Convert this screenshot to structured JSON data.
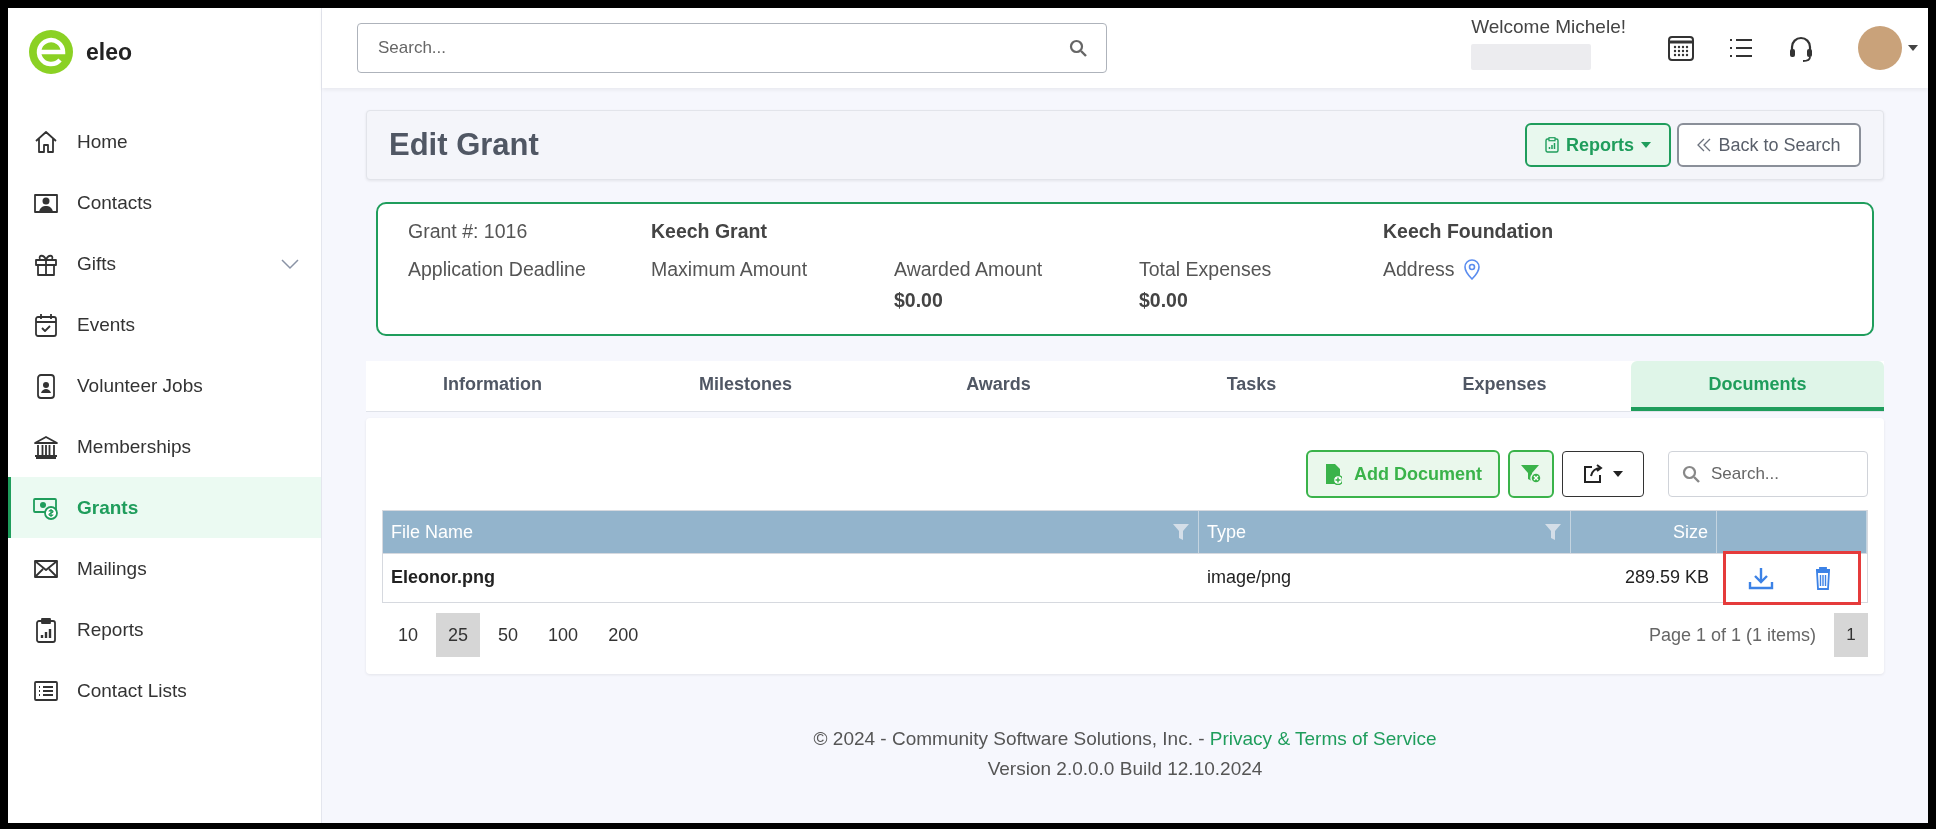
{
  "brand": {
    "name": "eleo"
  },
  "sidebar": {
    "items": [
      {
        "label": "Home",
        "kind": "link",
        "selected": false
      },
      {
        "label": "Contacts",
        "kind": "link",
        "selected": false
      },
      {
        "label": "Gifts",
        "kind": "group",
        "expanded": false,
        "selected": false
      },
      {
        "label": "Events",
        "kind": "link",
        "selected": false
      },
      {
        "label": "Volunteer Jobs",
        "kind": "link",
        "selected": false
      },
      {
        "label": "Memberships",
        "kind": "link",
        "selected": false
      },
      {
        "label": "Grants",
        "kind": "link",
        "selected": true
      },
      {
        "label": "Mailings",
        "kind": "link",
        "selected": false
      },
      {
        "label": "Reports",
        "kind": "link",
        "selected": false
      },
      {
        "label": "Contact Lists",
        "kind": "link",
        "selected": false
      }
    ]
  },
  "header": {
    "search": {
      "placeholder": "Search..."
    },
    "welcome": "Welcome Michele!"
  },
  "page": {
    "title": "Edit Grant",
    "buttons": [
      {
        "label": "Reports",
        "kind": "dropdown"
      },
      {
        "label": "Back to Search",
        "kind": "back"
      }
    ]
  },
  "summary": {
    "grant_number": "Grant #: 1016",
    "grant_name": "Keech Grant",
    "funder": "Keech Foundation",
    "fields": [
      {
        "label": "Application Deadline",
        "kind": "text"
      },
      {
        "label": "Maximum Amount",
        "kind": "text"
      },
      {
        "label": "Awarded Amount",
        "kind": "text",
        "value": "$0.00"
      },
      {
        "label": "Total Expenses",
        "kind": "text",
        "value": "$0.00"
      },
      {
        "label": "Address",
        "kind": "address"
      }
    ]
  },
  "tabs": [
    {
      "label": "Information",
      "selected": false
    },
    {
      "label": "Milestones",
      "selected": false
    },
    {
      "label": "Awards",
      "selected": false
    },
    {
      "label": "Tasks",
      "selected": false
    },
    {
      "label": "Expenses",
      "selected": false
    },
    {
      "label": "Documents",
      "selected": true
    }
  ],
  "toolbar": {
    "add_button": "Add Document",
    "search": {
      "placeholder": "Search..."
    }
  },
  "table": {
    "columns": [
      {
        "label": "File Name",
        "filter": true,
        "kind": "text"
      },
      {
        "label": "Type",
        "filter": true,
        "kind": "text"
      },
      {
        "label": "Size",
        "filter": false,
        "kind": "number"
      }
    ],
    "rows": [
      {
        "cells": [
          "Eleonor.png",
          "image/png",
          "289.59 KB"
        ],
        "actions_highlighted": true
      }
    ]
  },
  "pager": {
    "sizes": [
      {
        "label": "10",
        "selected": false
      },
      {
        "label": "25",
        "selected": true
      },
      {
        "label": "50",
        "selected": false
      },
      {
        "label": "100",
        "selected": false
      },
      {
        "label": "200",
        "selected": false
      }
    ],
    "info": "Page 1 of 1 (1 items)",
    "pages": [
      {
        "label": "1",
        "selected": true
      }
    ]
  },
  "footer": {
    "copyright": "© 2024 - Community Software Solutions, Inc. - ",
    "link": "Privacy & Terms of Service",
    "version": "Version 2.0.0.0 Build 12.10.2024"
  }
}
